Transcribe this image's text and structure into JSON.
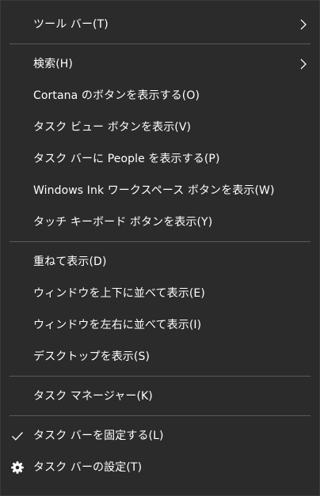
{
  "menu": {
    "toolbar": "ツール バー(T)",
    "search": "検索(H)",
    "cortana": "Cortana のボタンを表示する(O)",
    "taskview": "タスク ビュー ボタンを表示(V)",
    "people": "タスク バーに People を表示する(P)",
    "ink": "Windows Ink ワークスペース ボタンを表示(W)",
    "keyboard": "タッチ キーボード ボタンを表示(Y)",
    "cascade": "重ねて表示(D)",
    "stacked": "ウィンドウを上下に並べて表示(E)",
    "sidebyside": "ウィンドウを左右に並べて表示(I)",
    "desktop": "デスクトップを表示(S)",
    "taskmanager": "タスク マネージャー(K)",
    "lock": "タスク バーを固定する(L)",
    "settings": "タスク バーの設定(T)"
  },
  "icons": {
    "submenu": "chevron-right-icon",
    "check": "checkmark-icon",
    "settings": "gear-icon"
  },
  "colors": {
    "background": "#2b2b2b",
    "text": "#ffffff",
    "separator": "#5a5a5a"
  }
}
